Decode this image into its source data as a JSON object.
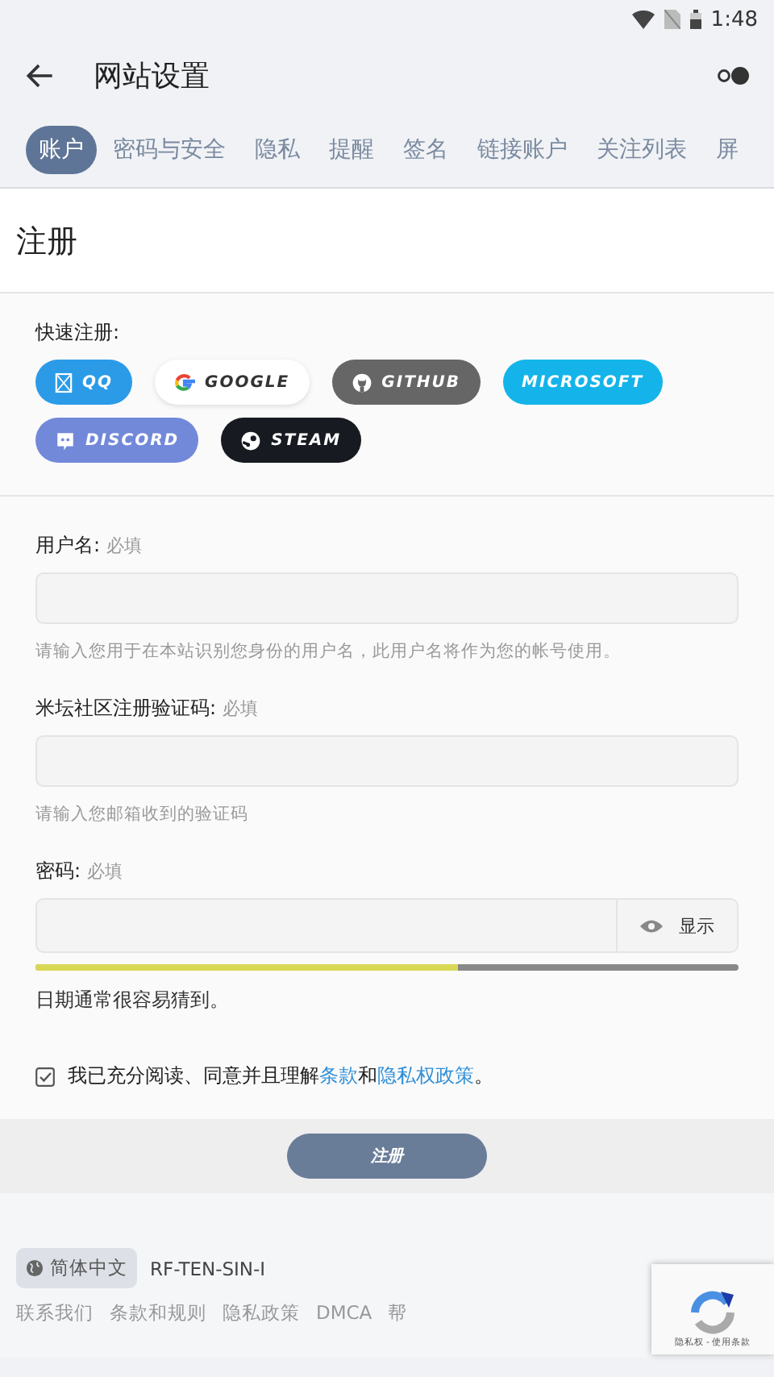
{
  "status_bar": {
    "time": "1:48"
  },
  "toolbar": {
    "title": "网站设置"
  },
  "tabs": [
    {
      "label": "账户",
      "selected": true
    },
    {
      "label": "密码与安全",
      "selected": false
    },
    {
      "label": "隐私",
      "selected": false
    },
    {
      "label": "提醒",
      "selected": false
    },
    {
      "label": "签名",
      "selected": false
    },
    {
      "label": "链接账户",
      "selected": false
    },
    {
      "label": "关注列表",
      "selected": false
    },
    {
      "label": "屏",
      "selected": false
    }
  ],
  "page_title": "注册",
  "quick_register": {
    "label": "快速注册:",
    "providers": [
      {
        "kind": "qq",
        "label": "QQ",
        "color": "#2b9be8"
      },
      {
        "kind": "google",
        "label": "GOOGLE",
        "color": "#ffffff"
      },
      {
        "kind": "github",
        "label": "GITHUB",
        "color": "#666666"
      },
      {
        "kind": "microsoft",
        "label": "MICROSOFT",
        "color": "#14b4ea"
      },
      {
        "kind": "discord",
        "label": "DISCORD",
        "color": "#7289da"
      },
      {
        "kind": "steam",
        "label": "STEAM",
        "color": "#171a21"
      }
    ]
  },
  "form": {
    "fields": [
      {
        "kind": "text",
        "label": "用户名:",
        "required": "必填",
        "hint": "请输入您用于在本站识别您身份的用户名，此用户名将作为您的帐号使用。"
      },
      {
        "kind": "text",
        "label": "米坛社区注册验证码:",
        "required": "必填",
        "hint": "请输入您邮箱收到的验证码"
      },
      {
        "kind": "password",
        "label": "密码:",
        "required": "必填",
        "show_button": "显示",
        "strength": {
          "level": 0.6
        },
        "hint": "日期通常很容易猜到。"
      }
    ],
    "agree": {
      "checked": true,
      "text": "我已充分阅读、同意并且理解",
      "terms_link": "条款",
      "and": "和",
      "privacy_link": "隐私权政策",
      "end": "。"
    },
    "submit": "注册"
  },
  "footer": {
    "language": "简体中文",
    "server": "RF-TEN-SIN-I",
    "links": [
      "联系我们",
      "条款和规则",
      "隐私政策",
      "DMCA",
      "帮"
    ]
  },
  "recaptcha": {
    "text": "隐私权 - 使用条款"
  }
}
